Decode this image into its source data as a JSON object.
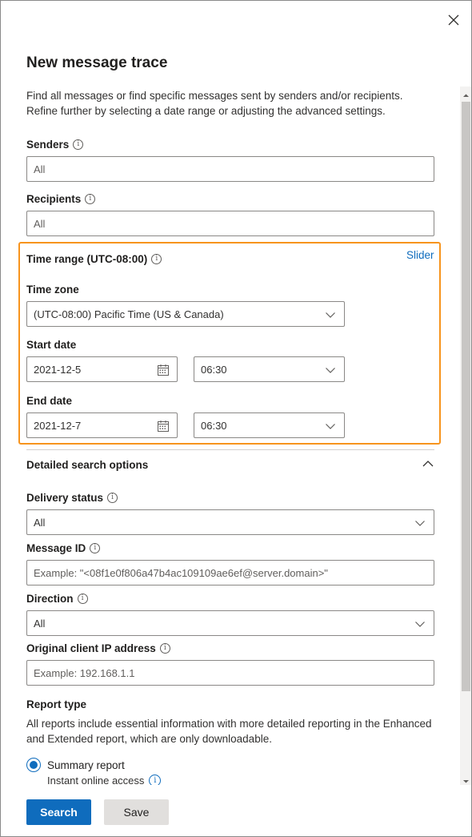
{
  "panel": {
    "title": "New message trace",
    "description": "Find all messages or find specific messages sent by senders and/or recipients. Refine further by selecting a date range or adjusting the advanced settings."
  },
  "senders": {
    "label": "Senders",
    "placeholder": "All"
  },
  "recipients": {
    "label": "Recipients",
    "placeholder": "All"
  },
  "time_range": {
    "label": "Time range (UTC-08:00)",
    "slider_link": "Slider",
    "time_zone_label": "Time zone",
    "time_zone_value": "(UTC-08:00) Pacific Time (US & Canada)",
    "start_date_label": "Start date",
    "start_date": "2021-12-5",
    "start_time": "06:30",
    "end_date_label": "End date",
    "end_date": "2021-12-7",
    "end_time": "06:30"
  },
  "detailed": {
    "header": "Detailed search options",
    "delivery_status_label": "Delivery status",
    "delivery_status_value": "All",
    "message_id_label": "Message ID",
    "message_id_placeholder": "Example: \"<08f1e0f806a47b4ac109109ae6ef@server.domain>\"",
    "direction_label": "Direction",
    "direction_value": "All",
    "client_ip_label": "Original client IP address",
    "client_ip_placeholder": "Example: 192.168.1.1",
    "report_type_label": "Report type",
    "report_type_desc": "All reports include essential information with more detailed reporting in the Enhanced and Extended report, which are only downloadable.",
    "summary_report_label": "Summary report",
    "summary_report_sub": "Instant online access"
  },
  "footer": {
    "search_label": "Search",
    "save_label": "Save"
  },
  "colors": {
    "accent": "#0f6cbd",
    "highlight": "#f7941d"
  }
}
